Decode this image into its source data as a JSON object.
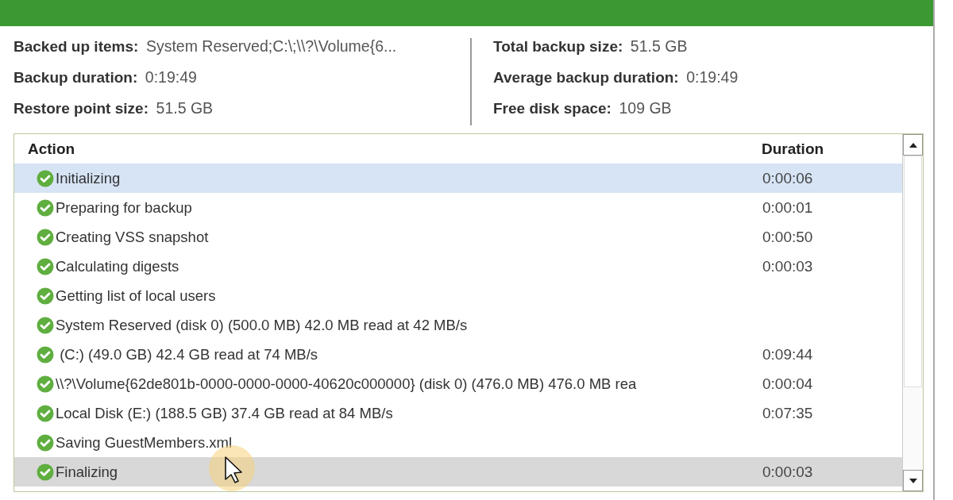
{
  "stats_left": [
    {
      "label": "Backed up items:",
      "value": "System Reserved;C:\\;\\\\?\\Volume{6..."
    },
    {
      "label": "Backup duration:",
      "value": "0:19:49"
    },
    {
      "label": "Restore point size:",
      "value": "51.5 GB"
    }
  ],
  "stats_right": [
    {
      "label": "Total backup size:",
      "value": "51.5 GB"
    },
    {
      "label": "Average backup duration:",
      "value": "0:19:49"
    },
    {
      "label": "Free disk space:",
      "value": "109 GB"
    }
  ],
  "table": {
    "columns": [
      "Action",
      "Duration"
    ],
    "rows": [
      {
        "kind": "success",
        "action": "Initializing",
        "duration": "0:00:06",
        "selected": true,
        "hovered": false
      },
      {
        "kind": "success",
        "action": "Preparing for backup",
        "duration": "0:00:01",
        "selected": false,
        "hovered": false
      },
      {
        "kind": "success",
        "action": "Creating VSS snapshot",
        "duration": "0:00:50",
        "selected": false,
        "hovered": false
      },
      {
        "kind": "success",
        "action": "Calculating digests",
        "duration": "0:00:03",
        "selected": false,
        "hovered": false
      },
      {
        "kind": "success",
        "action": "Getting list of local users",
        "selected": false,
        "hovered": false
      },
      {
        "kind": "success",
        "action": "System Reserved (disk 0) (500.0 MB) 42.0 MB read at 42 MB/s",
        "selected": false,
        "hovered": false
      },
      {
        "kind": "success",
        "action": " (C:) (49.0 GB) 42.4 GB read at 74 MB/s",
        "duration": "0:09:44",
        "selected": false,
        "hovered": false
      },
      {
        "kind": "success",
        "action": "\\\\?\\Volume{62de801b-0000-0000-0000-40620c000000} (disk 0) (476.0 MB) 476.0 MB rea",
        "duration": "0:00:04",
        "selected": false,
        "hovered": false
      },
      {
        "kind": "success",
        "action": "Local Disk (E:) (188.5 GB) 37.4 GB read at 84 MB/s",
        "duration": "0:07:35",
        "selected": false,
        "hovered": false
      },
      {
        "kind": "success",
        "action": "Saving GuestMembers.xml",
        "selected": false,
        "hovered": false
      },
      {
        "kind": "success",
        "action": "Finalizing",
        "duration": "0:00:03",
        "selected": false,
        "hovered": true
      }
    ]
  }
}
